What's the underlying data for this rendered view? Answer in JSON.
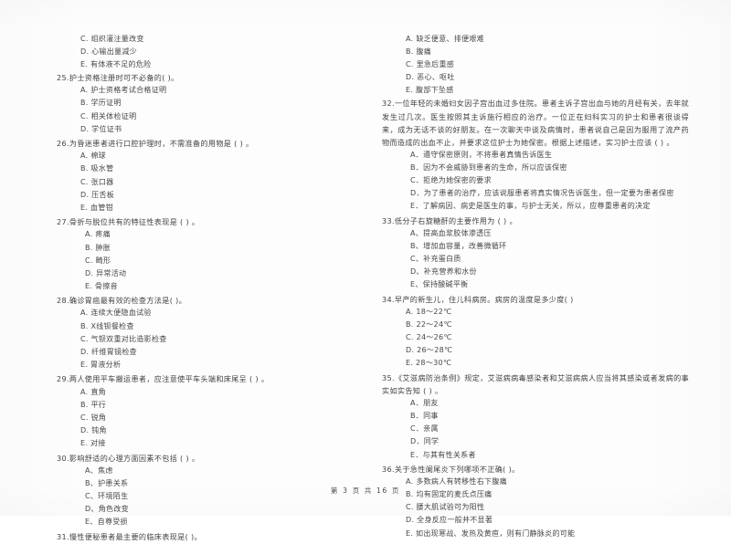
{
  "document": {
    "type": "exam-paper",
    "language": "zh-CN",
    "footer": "第 3 页 共 16 页"
  },
  "left_column": {
    "continued_options": [
      "C. 组织灌注量改变",
      "D. 心输出量减少",
      "E. 有体液不足的危险"
    ],
    "questions": [
      {
        "number": "25.",
        "stem": "护士资格注册时可不必备的(        )。",
        "options": [
          "A. 护士资格考试合格证明",
          "B. 学历证明",
          "C. 相关体检证明",
          "D. 学位证书"
        ]
      },
      {
        "number": "26.",
        "stem": "为昏迷患者进行口腔护理时，不需准备的用物是 (        ) 。",
        "options": [
          "A. 棉球",
          "B. 吸水管",
          "C. 张口器",
          "D. 压舌板",
          "E. 血管钳"
        ]
      },
      {
        "number": "27.",
        "stem": "骨折与脱位共有的特征性表现是 (        ) 。",
        "options": [
          "A.  疼痛",
          "B.  肿胀",
          "C.  畸形",
          "D.  异常活动",
          "E.  骨擦音"
        ]
      },
      {
        "number": "28.",
        "stem": "确诊胃癌最有效的检查方法是(        )。",
        "options": [
          "A. 连续大便隐血试验",
          "B. X线钡餐检查",
          "C. 气钡双重对比造影检查",
          "D. 纤维胃镜检查",
          "E. 胃液分析"
        ]
      },
      {
        "number": "29.",
        "stem": "两人使用平车搬运患者，应注意使平车头端和床尾呈 (        ) 。",
        "options": [
          "A. 直角",
          "B. 平行",
          "C. 锐角",
          "D. 钝角",
          "E. 对接"
        ]
      },
      {
        "number": "30.",
        "stem": "影响舒适的心理方面因素不包括 (        ) 。",
        "options": [
          "A、焦虑",
          "B、护患关系",
          "C、环境陌生",
          "D、角色改变",
          "E、自尊受损"
        ]
      },
      {
        "number": "31.",
        "stem": "慢性便秘患者最主要的临床表现是(          )。",
        "options": []
      }
    ]
  },
  "right_column": {
    "continued_options": [
      "A. 缺乏便意、排便艰难",
      "B. 腹痛",
      "C. 里急后重感",
      "D. 恶心、呕吐",
      "E. 腹部下坠感"
    ],
    "questions": [
      {
        "number": "32.",
        "stem": "一位年轻的未婚妇女因子宫出血过多住院。患者主诉子宫出血与她的月经有关，去年就发生过几次。医生按照其主诉施行相应的治疗。一位正在妇科实习的护士和患者很谈得来，成为无话不谈的好朋友。在一次聊天中谈及病情时，患者说自己是因为服用了流产药物而造成的出血不止，并要求这位护士为她保密。根据上述描述，实习护士应该 (        ) 。",
        "options": [
          "A．遵守保密原则，不将患者真情告诉医生",
          "B．因为不会威胁到患者的生命，所以应该保密",
          "C．拒绝为她保密的要求",
          "D．为了患者的治疗，应该说服患者将真实情况告诉医生，但一定要为患者保密",
          "E．了解病因、病史是医生的事，与护士无关，所以，应尊重患者的决定"
        ]
      },
      {
        "number": "33.",
        "stem": "低分子右旋糖酐的主要作用为 (        ) 。",
        "options": [
          "A、提高血浆胶体渗透压",
          "B、增加血容量，改善微循环",
          "C、补充蛋白质",
          "D、补充营养和水份",
          "E、保持酸碱平衡"
        ]
      },
      {
        "number": "34.",
        "stem": "早产的新生儿，住儿科病房。病房的温度是多少度(        )",
        "options": [
          "A. 18～22℃",
          "B. 22～24℃",
          "C. 24～26℃",
          "D. 26～28℃",
          "E. 28～30℃"
        ]
      },
      {
        "number": "35.",
        "stem": "《艾滋病防治条例》规定，艾滋病病毒感染者和艾滋病病人应当将其感染或者发病的事实如实告知 (        ) 。",
        "options": [
          "A．朋友",
          "B．同事",
          "C．亲属",
          "D．同学",
          "E．与其有性关系者"
        ]
      },
      {
        "number": "36.",
        "stem": "关于急性阑尾炎下列哪项不正确(        )。",
        "options": [
          "A. 多数病人有转移性右下腹痛",
          "B. 均有固定的麦氏点压痛",
          "C. 腰大肌试验可为阳性",
          "D. 全身反应一般并不显著",
          "E. 如出现寒战、发热及黄疸，则有门静脉炎的可能"
        ]
      }
    ]
  }
}
